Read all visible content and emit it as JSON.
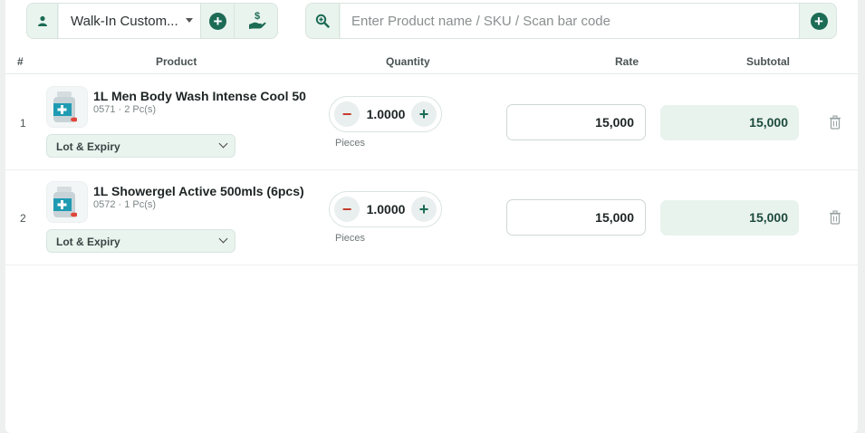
{
  "customer": {
    "selected": "Walk-In Custom..."
  },
  "search": {
    "placeholder": "Enter Product name / SKU / Scan bar code"
  },
  "table": {
    "headers": {
      "num": "#",
      "product": "Product",
      "quantity": "Quantity",
      "rate": "Rate",
      "subtotal": "Subtotal"
    },
    "rows": [
      {
        "num": "1",
        "name": "1L Men Body Wash Intense Cool 50",
        "meta": "0571  ·  2 Pc(s)",
        "lot_label": "Lot & Expiry",
        "qty": "1.0000",
        "unit": "Pieces",
        "rate": "15,000",
        "subtotal": "15,000"
      },
      {
        "num": "2",
        "name": "1L Showergel Active 500mls (6pcs)",
        "meta": "0572  ·  1 Pc(s)",
        "lot_label": "Lot & Expiry",
        "qty": "1.0000",
        "unit": "Pieces",
        "rate": "15,000",
        "subtotal": "15,000"
      }
    ]
  },
  "colors": {
    "accent": "#1c6b55",
    "minus": "#c53b2c",
    "subtotal_bg": "#e9f3ee"
  },
  "icons": {
    "customer": "user-icon",
    "add_customer": "plus-circle-icon",
    "payment": "hand-money-icon",
    "search": "zoom-search-icon",
    "add_product": "plus-circle-icon",
    "delete": "trash-icon"
  }
}
